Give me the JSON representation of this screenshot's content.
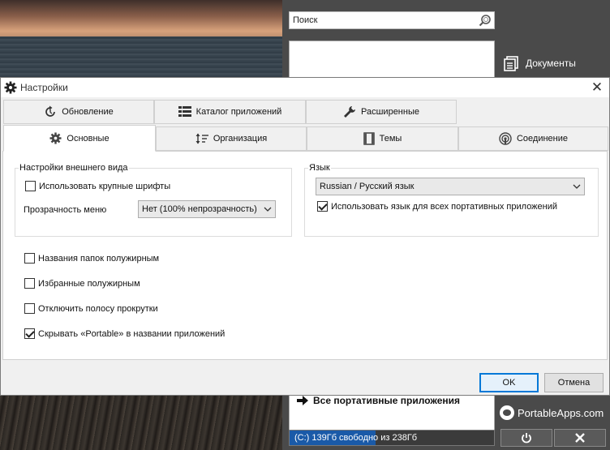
{
  "portableapps": {
    "search_placeholder": "Поиск",
    "right_items": [
      {
        "label": "Документы",
        "icon": "documents-icon"
      }
    ],
    "all_apps_label": "Все портативные приложения",
    "brand": "PortableApps.com",
    "drive_status": "(C:) 139Гб свободно из 238Гб",
    "drive_used_fraction": 0.42,
    "power_icon": "power-icon",
    "close_icon": "close-icon"
  },
  "dialog": {
    "title": "Настройки",
    "tabs_row1": [
      {
        "label": "Обновление",
        "icon": "update-icon"
      },
      {
        "label": "Каталог приложений",
        "icon": "catalog-icon"
      },
      {
        "label": "Расширенные",
        "icon": "wrench-icon"
      }
    ],
    "tabs_row2": [
      {
        "label": "Основные",
        "icon": "gear-icon",
        "active": true
      },
      {
        "label": "Организация",
        "icon": "sort-icon"
      },
      {
        "label": "Темы",
        "icon": "themes-icon"
      },
      {
        "label": "Соединение",
        "icon": "connection-icon"
      }
    ],
    "appearance": {
      "title": "Настройки внешнего вида",
      "large_fonts_label": "Использовать крупные шрифты",
      "large_fonts_checked": false,
      "transparency_label": "Прозрачность меню",
      "transparency_value": "Нет (100% непрозрачность)"
    },
    "language": {
      "title": "Язык",
      "value": "Russian / Русский язык",
      "all_apps_label": "Использовать язык для всех портативных приложений",
      "all_apps_checked": true
    },
    "options": [
      {
        "label": "Названия папок полужирным",
        "checked": false
      },
      {
        "label": "Избранные полужирным",
        "checked": false
      },
      {
        "label": "Отключить полосу прокрутки",
        "checked": false
      },
      {
        "label": "Скрывать «Portable» в названии приложений",
        "checked": true
      }
    ],
    "ok_label": "OK",
    "cancel_label": "Отмена"
  }
}
